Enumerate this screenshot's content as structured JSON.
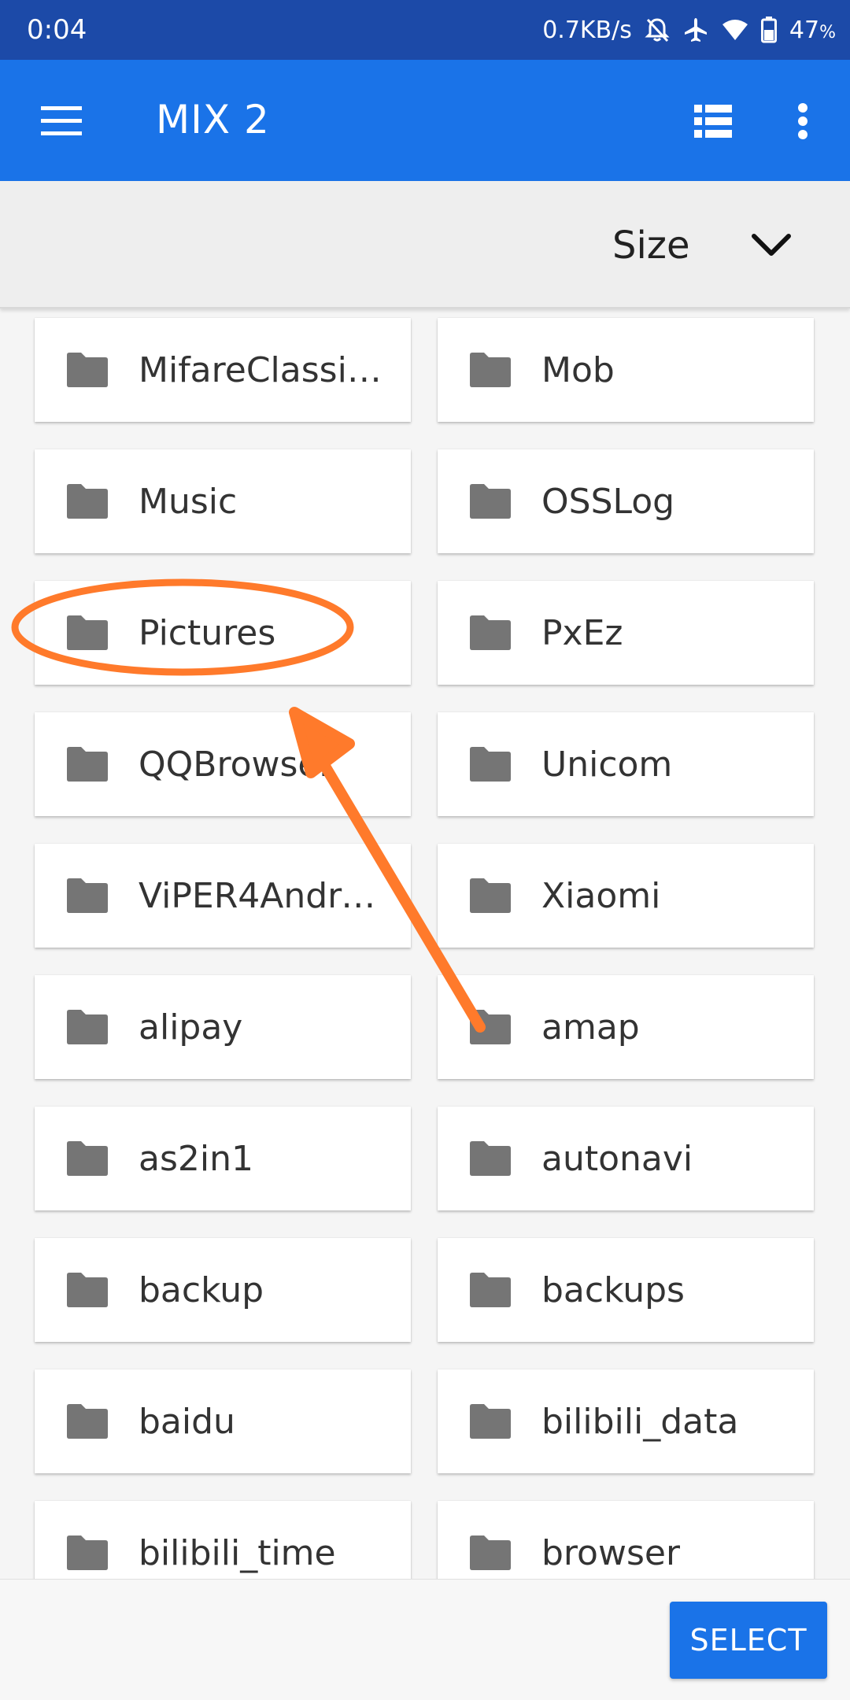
{
  "status_bar": {
    "time": "0:04",
    "network_speed": "0.7KB/s",
    "battery_percent": "47",
    "battery_unit": "%",
    "icons": [
      "mute-icon",
      "airplane-mode-icon",
      "wifi-icon",
      "battery-icon"
    ]
  },
  "app_bar": {
    "title": "MIX 2",
    "icons": [
      "menu-icon",
      "list-view-icon",
      "more-vert-icon"
    ],
    "color": "#1a73e8"
  },
  "sort": {
    "label": "Size",
    "icon": "chevron-down-icon"
  },
  "folders": [
    "MifareClassic…",
    "Mob",
    "Music",
    "OSSLog",
    "Pictures",
    "PxEz",
    "QQBrowser",
    "Unicom",
    "ViPER4Android",
    "Xiaomi",
    "alipay",
    "amap",
    "as2in1",
    "autonavi",
    "backup",
    "backups",
    "baidu",
    "bilibili_data",
    "bilibili_time",
    "browser"
  ],
  "folder_icon": "folder-icon",
  "bottom": {
    "select_label": "SELECT"
  },
  "annotation": {
    "color": "#ff7a2b",
    "highlighted_item": "Pictures"
  }
}
